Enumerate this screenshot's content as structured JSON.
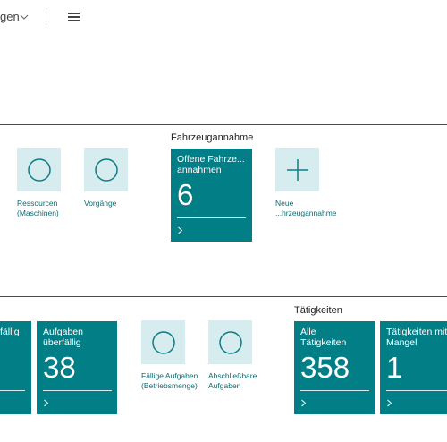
{
  "header": {
    "menu_label": "gen",
    "chevron_icon": "chevron-down-icon",
    "menu_icon": "hamburger-menu-icon"
  },
  "sections": {
    "fahrzeugannahme_title": "Fahrzeugannahme",
    "taetigkeiten_title": "Tätigkeiten"
  },
  "actions_row1": [
    {
      "label_line1": "Ressourcen",
      "label_line2": "(Maschinen)",
      "icon": "circle-icon"
    },
    {
      "label_line1": "Vorgänge",
      "label_line2": "",
      "icon": "circle-icon"
    },
    {
      "label_line1": "Neue",
      "label_line2": "...hrzeugannahme",
      "icon": "plus-icon"
    }
  ],
  "cues_row1": [
    {
      "title_line1": "Offene Fahrze...",
      "title_line2": "annahmen",
      "value": "6"
    }
  ],
  "cues_row2": [
    {
      "title_line1": "fällig",
      "title_line2": "",
      "value": ""
    },
    {
      "title_line1": "Aufgaben",
      "title_line2": "überfällig",
      "value": "38"
    },
    {
      "title_line1": "Alle",
      "title_line2": "Tätigkeiten",
      "value": "358"
    },
    {
      "title_line1": "Tätigkeiten mit",
      "title_line2": "Mangel",
      "value": "1"
    }
  ],
  "actions_row2": [
    {
      "label_line1": "Fällige Aufgaben",
      "label_line2": "(Betriebsmenge)",
      "icon": "circle-icon"
    },
    {
      "label_line1": "Abschließbare",
      "label_line2": "Aufgaben",
      "icon": "circle-icon"
    }
  ],
  "colors": {
    "cue_background": "#027e87",
    "action_background": "#d6ecee",
    "action_icon": "#0e7c86"
  }
}
